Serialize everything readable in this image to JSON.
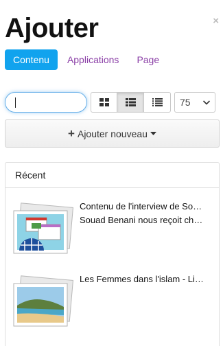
{
  "header": {
    "title": "Ajouter",
    "close_label": "×"
  },
  "tabs": [
    {
      "label": "Contenu",
      "active": true
    },
    {
      "label": "Applications",
      "active": false
    },
    {
      "label": "Page",
      "active": false
    }
  ],
  "toolbar": {
    "search_value": "",
    "view_modes": [
      "grid-icon",
      "list-detail-icon",
      "list-icon"
    ],
    "active_view": "list-detail-icon",
    "page_size": "75",
    "add_new_label": "Ajouter nouveau"
  },
  "recent": {
    "heading": "Récent",
    "items": [
      {
        "title": "Contenu de l'interview de So…",
        "subtitle": "Souad Benani nous reçoit ch…"
      },
      {
        "title": "Les Femmes dans l'islam - Li…",
        "subtitle": ""
      }
    ]
  },
  "colors": {
    "accent": "#11a3ee",
    "link": "#8a3ea6"
  }
}
